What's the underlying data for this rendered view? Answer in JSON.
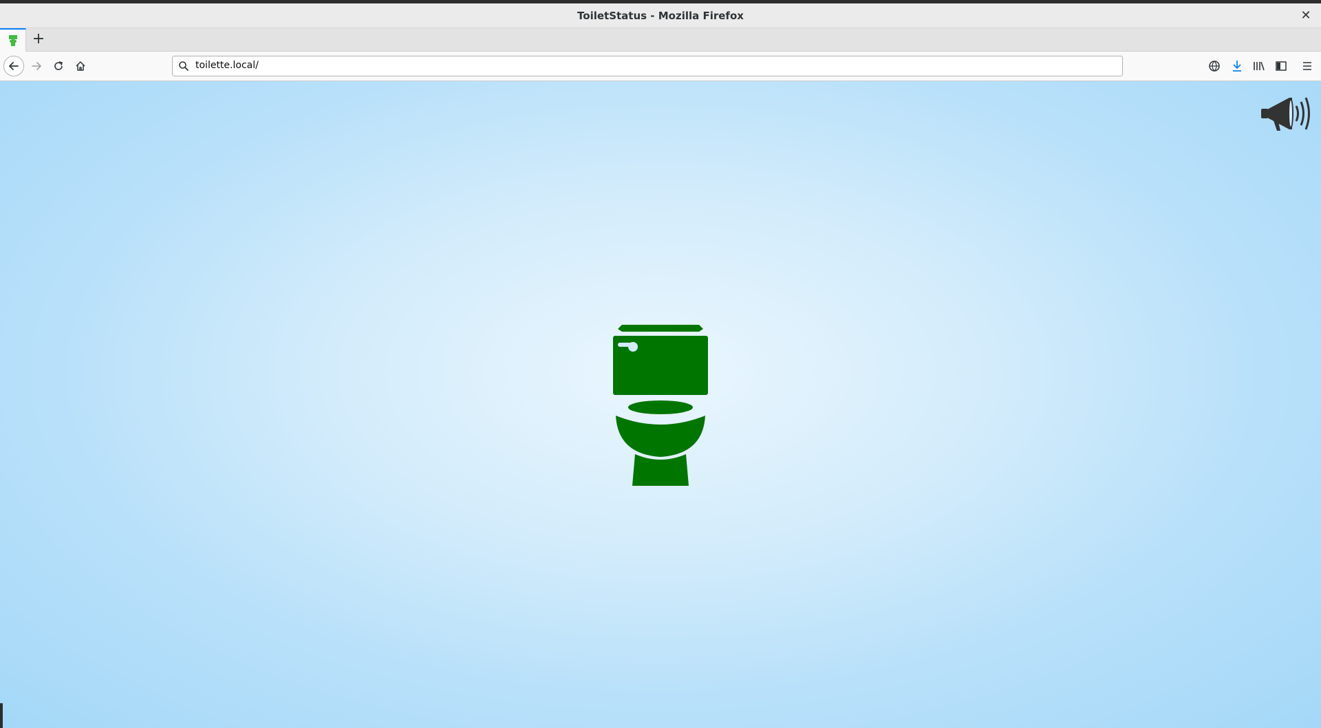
{
  "window": {
    "title": "ToiletStatus - Mozilla Firefox",
    "close_glyph": "✕"
  },
  "tabs": {
    "active_tab_icon": "toilet-favicon",
    "new_tab_glyph": "+"
  },
  "navbar": {
    "url": "toilette.local/"
  },
  "content": {
    "status_icon": "toilet-icon",
    "status_color": "#007500",
    "announce_icon": "megaphone-icon"
  }
}
